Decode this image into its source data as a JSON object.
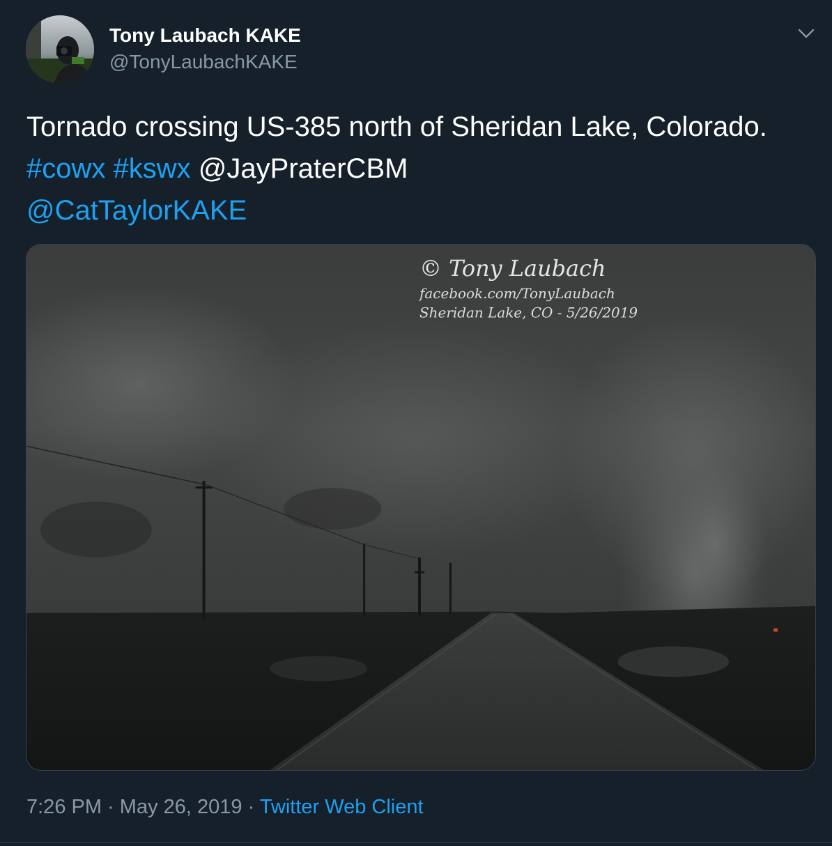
{
  "author": {
    "display_name": "Tony Laubach KAKE",
    "handle": "@TonyLaubachKAKE",
    "avatar_icon": "user-avatar"
  },
  "menu": {
    "icon": "chevron-down-icon"
  },
  "tweet": {
    "text_before_links": "Tornado crossing US-385 north of Sheridan Lake, Colorado. ",
    "hashtag_1": "#cowx",
    "hashtag_2": "#kswx",
    "mention_1": "@JayPraterCBM",
    "mention_2": "@CatTaylorKAKE"
  },
  "media": {
    "watermark_line1": "© Tony Laubach",
    "watermark_line2": "facebook.com/TonyLaubach",
    "watermark_line3": "Sheridan Lake, CO - 5/26/2019"
  },
  "meta": {
    "time": "7:26 PM",
    "separator_1": " · ",
    "date": "May 26, 2019",
    "separator_2": " · ",
    "source": "Twitter Web Client"
  },
  "colors": {
    "background": "#15202b",
    "text_primary": "#ffffff",
    "text_secondary": "#8899a6",
    "link": "#1da1f2",
    "border": "#38444d"
  }
}
